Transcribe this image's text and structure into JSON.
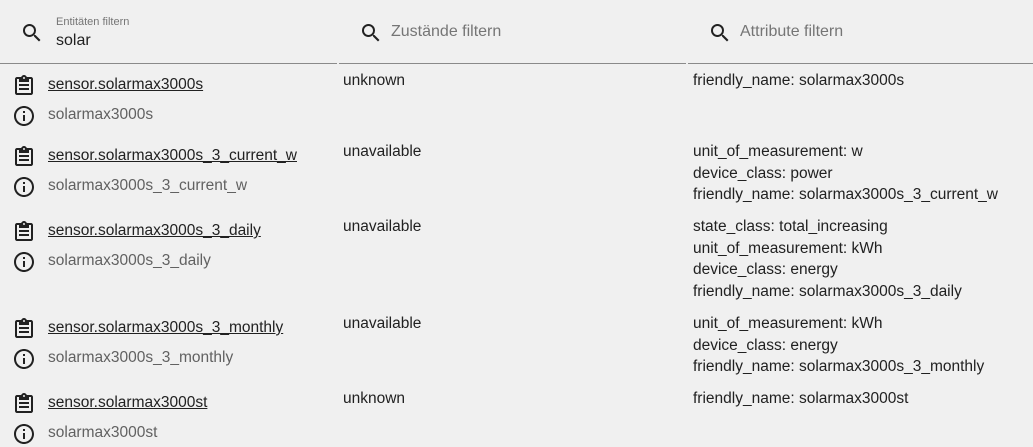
{
  "filters": {
    "entities": {
      "label": "Entitäten filtern",
      "value": "solar"
    },
    "states": {
      "placeholder": "Zustände filtern"
    },
    "attributes": {
      "placeholder": "Attribute filtern"
    }
  },
  "rows": [
    {
      "entity_id": "sensor.solarmax3000s",
      "name": "solarmax3000s",
      "state": "unknown",
      "attributes": [
        "friendly_name: solarmax3000s"
      ]
    },
    {
      "entity_id": "sensor.solarmax3000s_3_current_w",
      "name": "solarmax3000s_3_current_w",
      "state": "unavailable",
      "attributes": [
        "unit_of_measurement: w",
        "device_class: power",
        "friendly_name: solarmax3000s_3_current_w"
      ]
    },
    {
      "entity_id": "sensor.solarmax3000s_3_daily",
      "name": "solarmax3000s_3_daily",
      "state": "unavailable",
      "attributes": [
        "state_class: total_increasing",
        "unit_of_measurement: kWh",
        "device_class: energy",
        "friendly_name: solarmax3000s_3_daily"
      ]
    },
    {
      "entity_id": "sensor.solarmax3000s_3_monthly",
      "name": "solarmax3000s_3_monthly",
      "state": "unavailable",
      "attributes": [
        "unit_of_measurement: kWh",
        "device_class: energy",
        "friendly_name: solarmax3000s_3_monthly"
      ]
    },
    {
      "entity_id": "sensor.solarmax3000st",
      "name": "solarmax3000st",
      "state": "unknown",
      "attributes": [
        "friendly_name: solarmax3000st"
      ]
    }
  ],
  "icons": {
    "filter": "search-icon",
    "copy": "clipboard-icon",
    "info": "info-icon"
  }
}
